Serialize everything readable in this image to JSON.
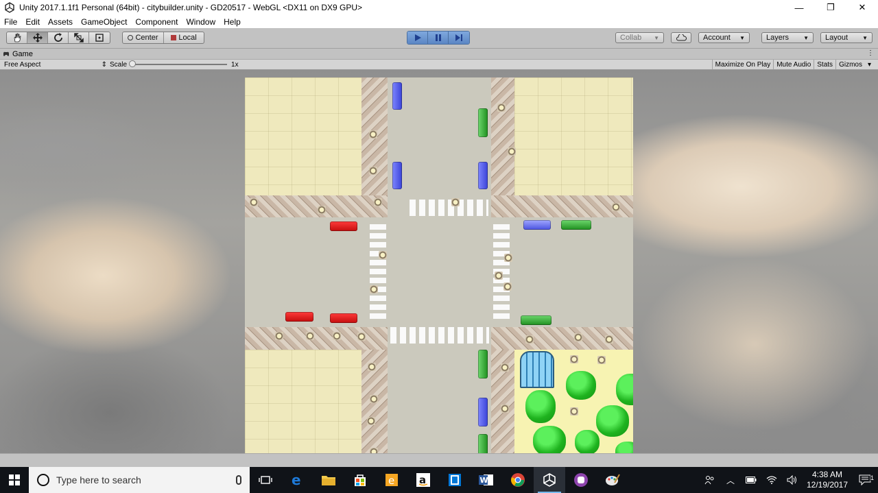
{
  "window": {
    "title": "Unity 2017.1.1f1 Personal (64bit) - citybuilder.unity - GD20517 - WebGL <DX11 on DX9 GPU>",
    "minimize": "—",
    "maximize": "❐",
    "close": "✕"
  },
  "menu": [
    "File",
    "Edit",
    "Assets",
    "GameObject",
    "Component",
    "Window",
    "Help"
  ],
  "toolbar": {
    "pivot_center": "Center",
    "pivot_local": "Local",
    "collab": "Collab",
    "account": "Account",
    "layers": "Layers",
    "layout": "Layout"
  },
  "game_tab": {
    "label": "Game",
    "aspect": "Free Aspect",
    "scale_label": "Scale",
    "scale_value": "1x",
    "maximize_on_play": "Maximize On Play",
    "mute_audio": "Mute Audio",
    "stats": "Stats",
    "gizmos": "Gizmos"
  },
  "taskbar": {
    "search_placeholder": "Type here to search",
    "time": "4:38 AM",
    "date": "12/19/2017",
    "notifications": "1"
  },
  "colors": {
    "play_accent": "#5b86c4",
    "taskbar": "#101318",
    "park": "#f7f3b2"
  }
}
